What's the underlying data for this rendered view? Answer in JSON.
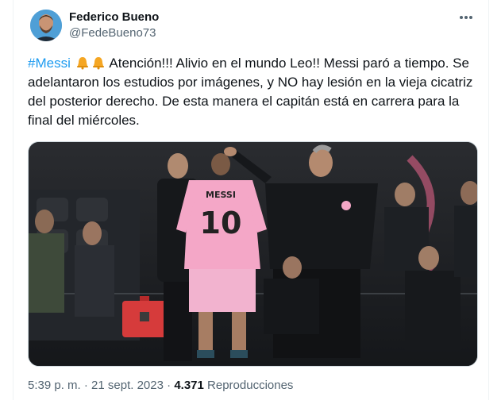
{
  "author": {
    "display_name": "Federico Bueno",
    "handle": "@FedeBueno73"
  },
  "tweet": {
    "hashtag": "#Messi",
    "emoji": "bell",
    "text": "Atención!!! Alivio en el mundo Leo!! Messi paró a tiempo. Se adelantaron los estudios por imágenes, y NO hay lesión en la vieja cicatriz del posterior derecho. De esta manera el capitán está en carrera para la final del miércoles."
  },
  "media": {
    "jersey_name": "MESSI",
    "jersey_number": "10"
  },
  "meta": {
    "time": "5:39 p. m.",
    "separator": "·",
    "date": "21 sept. 2023",
    "views": "4.371",
    "views_label": "Reproducciones"
  },
  "icons": {
    "more": "more-dots-icon",
    "bell": "bell-emoji-icon"
  },
  "colors": {
    "link": "#1d9bf0",
    "secondary_text": "#536471",
    "jersey_pink": "#f4a7c7"
  }
}
